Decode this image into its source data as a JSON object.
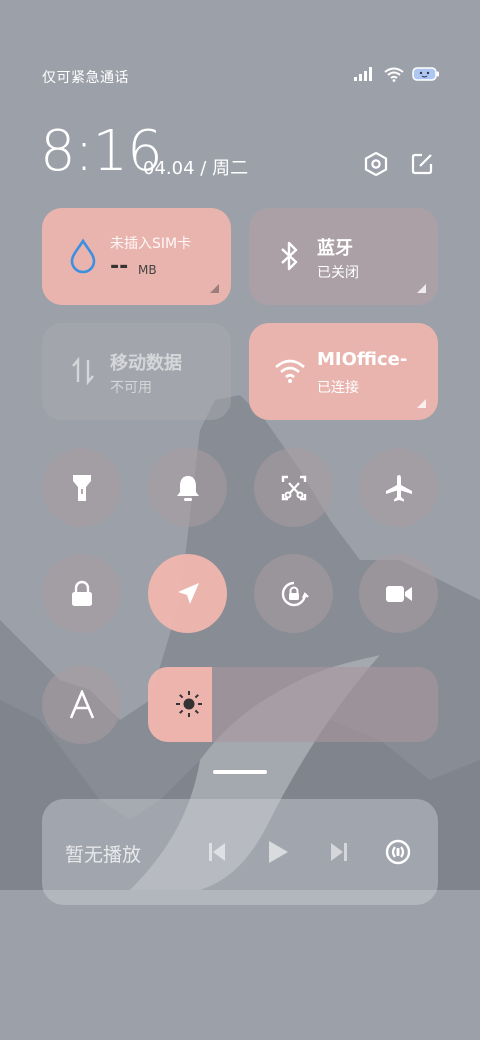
{
  "status_bar": {
    "carrier": "仅可紧急通话",
    "icons": [
      "signal-icon",
      "wifi-icon",
      "battery-icon"
    ]
  },
  "header": {
    "time": "8:16",
    "date": "04.04",
    "separator": "/",
    "weekday": "周二",
    "icons": [
      "settings-icon",
      "edit-icon"
    ]
  },
  "tiles": {
    "data_usage": {
      "title": "未插入SIM卡",
      "value": "--",
      "unit": "MB",
      "icon": "water-drop-icon",
      "color": "#f0b6ae"
    },
    "bluetooth": {
      "title": "蓝牙",
      "status": "已关闭",
      "icon": "bluetooth-icon"
    },
    "mobile_data": {
      "title": "移动数据",
      "status": "不可用",
      "icon": "data-arrows-icon"
    },
    "wifi": {
      "title": "MIOffice-",
      "status": "已连接",
      "icon": "wifi-icon",
      "color": "#f0b6ae"
    }
  },
  "toggles": [
    {
      "name": "flashlight",
      "icon": "flashlight-icon",
      "on": false
    },
    {
      "name": "ringer",
      "icon": "bell-icon",
      "on": false
    },
    {
      "name": "screenshot",
      "icon": "screenshot-icon",
      "on": false
    },
    {
      "name": "airplane",
      "icon": "airplane-icon",
      "on": false
    },
    {
      "name": "lock",
      "icon": "lock-icon",
      "on": false
    },
    {
      "name": "location",
      "icon": "location-icon",
      "on": true
    },
    {
      "name": "rotation-lock",
      "icon": "rotation-lock-icon",
      "on": false
    },
    {
      "name": "screen-record",
      "icon": "video-camera-icon",
      "on": false
    },
    {
      "name": "auto-brightness",
      "icon": "font-a-icon",
      "on": false
    }
  ],
  "brightness": {
    "level": 0.22,
    "icon": "sun-icon"
  },
  "media": {
    "status": "暂无播放",
    "controls": [
      "previous-icon",
      "play-icon",
      "next-icon",
      "cast-icon"
    ]
  }
}
